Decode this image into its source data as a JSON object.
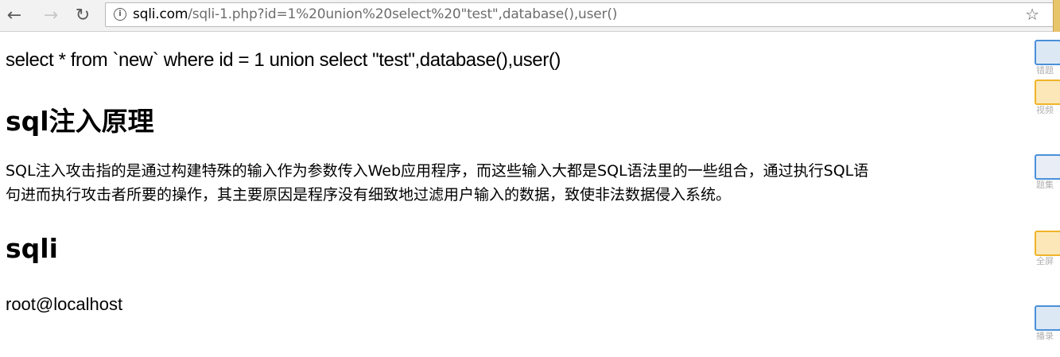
{
  "browser": {
    "back_glyph": "←",
    "forward_glyph": "→",
    "reload_glyph": "↻",
    "info_glyph": "i",
    "url_host": "sqli.com",
    "url_path": "/sqli-1.php?id=1%20union%20select%20\"test\",database(),user()",
    "star_glyph": "☆"
  },
  "page": {
    "query": "select * from `new` where id = 1 union select \"test\",database(),user()",
    "heading_principle": "sql注入原理",
    "paragraph_line1": "SQL注入攻击指的是通过构建特殊的输入作为参数传入Web应用程序，而这些输入大都是SQL语法里的一些组合，通过执行SQL语",
    "paragraph_line2": "句进而执行攻击者所要的操作，其主要原因是程序没有细致地过滤用户输入的数据，致使非法数据侵入系统。",
    "heading_sqli": "sqli",
    "result": "root@localhost"
  },
  "side_panel": {
    "items": [
      {
        "label": "错题",
        "icon": "blue-monitor-icon",
        "color": "#4a90d9"
      },
      {
        "label": "视频",
        "icon": "yellow-pencil-icon",
        "color": "#f0b429"
      },
      {
        "label": "题集",
        "icon": "blue-scissors-icon",
        "color": "#4a90d9"
      },
      {
        "label": "全屏",
        "icon": "yellow-notes-icon",
        "color": "#f0b429"
      },
      {
        "label": "播录",
        "icon": "blue-screen-icon",
        "color": "#4a90d9"
      }
    ]
  },
  "colors": {
    "toolbar_bg": "#f2f2f2",
    "url_path": "#6d6d6d",
    "side_label": "#b0b0b0"
  }
}
